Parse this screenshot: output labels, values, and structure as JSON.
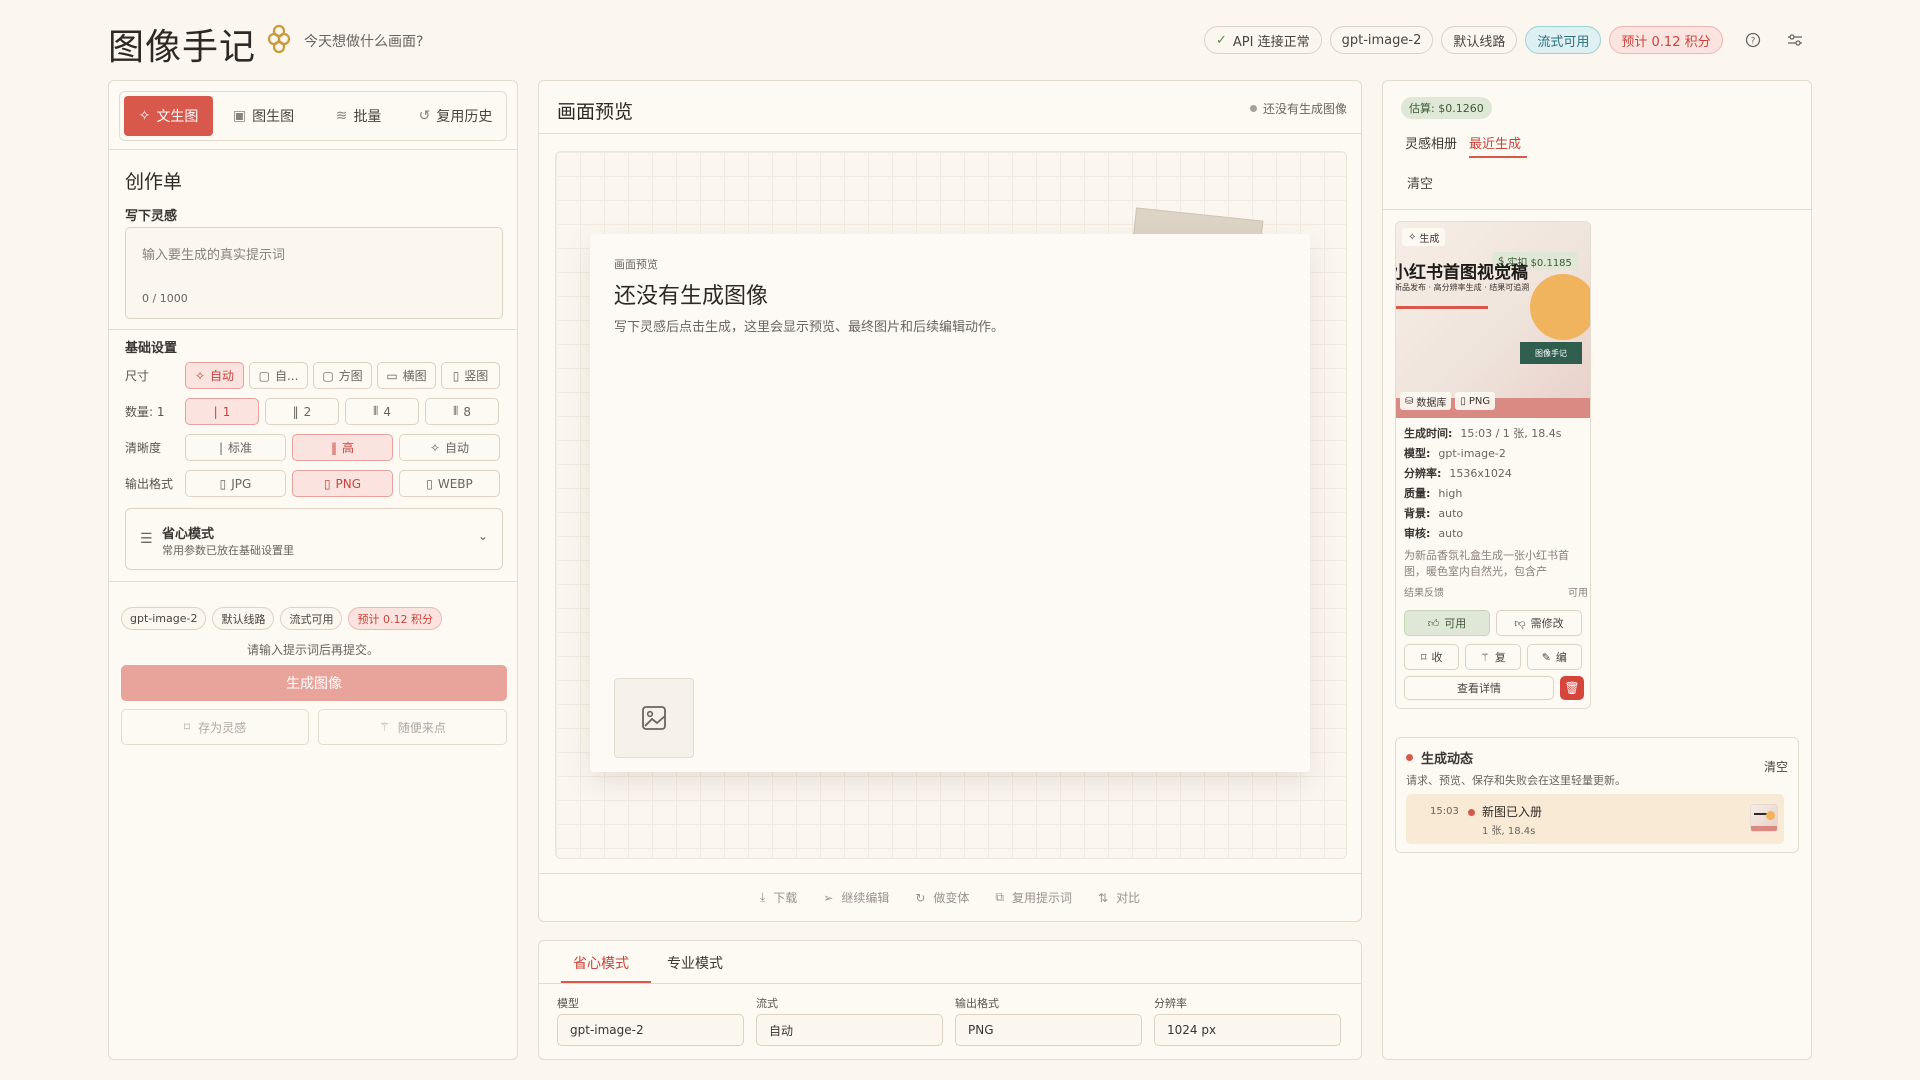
{
  "header": {
    "title": "图像手记",
    "subtitle": "今天想做什么画面?",
    "api_status": "API 连接正常",
    "model": "gpt-image-2",
    "route": "默认线路",
    "stream": "流式可用",
    "cost": "预计 0.12 积分"
  },
  "left": {
    "tabs": [
      "文生图",
      "图生图",
      "批量",
      "复用历史"
    ],
    "section_title": "创作单",
    "prompt_label": "写下灵感",
    "prompt_placeholder": "输入要生成的真实提示词",
    "prompt_count": "0 / 1000",
    "basic_title": "基础设置",
    "size_label": "尺寸",
    "size_options": [
      "自动",
      "自...",
      "方图",
      "横图",
      "竖图"
    ],
    "count_label": "数量: 1",
    "count_options": [
      "1",
      "2",
      "4",
      "8"
    ],
    "quality_label": "清晰度",
    "quality_options": [
      "标准",
      "高",
      "自动"
    ],
    "format_label": "输出格式",
    "format_options": [
      "JPG",
      "PNG",
      "WEBP"
    ],
    "easy_title": "省心模式",
    "easy_desc": "常用参数已放在基础设置里",
    "chips": [
      "gpt-image-2",
      "默认线路",
      "流式可用",
      "预计 0.12 积分"
    ],
    "hint": "请输入提示词后再提交。",
    "generate_label": "生成图像",
    "save_label": "存为灵感",
    "random_label": "随便来点"
  },
  "preview": {
    "title": "画面预览",
    "status": "还没有生成图像",
    "card_kicker": "画面预览",
    "card_title": "还没有生成图像",
    "card_desc": "写下灵感后点击生成，这里会显示预览、最终图片和后续编辑动作。",
    "toolbar": [
      "下载",
      "继续编辑",
      "做变体",
      "复用提示词",
      "对比"
    ]
  },
  "bottom": {
    "tabs": [
      "省心模式",
      "专业模式"
    ],
    "fields": [
      {
        "label": "模型",
        "value": "gpt-image-2"
      },
      {
        "label": "流式",
        "value": "自动"
      },
      {
        "label": "输出格式",
        "value": "PNG"
      },
      {
        "label": "分辨率",
        "value": "1024 px"
      }
    ]
  },
  "right": {
    "estimate": "估算: $0.1260",
    "tabs": [
      "灵感相册",
      "最近生成"
    ],
    "clear": "清空",
    "thumb": {
      "badge": "生成",
      "cost": "实扣 $0.1185",
      "headline": "小红书首图视觉稿",
      "tagline": "新品发布 · 高分辨率生成 · 结果可追溯",
      "brand": "图像手记",
      "tag_db": "数据库",
      "tag_fmt": "PNG"
    },
    "meta": [
      {
        "k": "生成时间:",
        "v": "15:03 / 1 张, 18.4s"
      },
      {
        "k": "模型:",
        "v": "gpt-image-2"
      },
      {
        "k": "分辨率:",
        "v": "1536x1024"
      },
      {
        "k": "质量:",
        "v": "high"
      },
      {
        "k": "背景:",
        "v": "auto"
      },
      {
        "k": "审核:",
        "v": "auto"
      }
    ],
    "desc": "为新品香氛礼盒生成一张小红书首图，暖色室内自然光，包含产",
    "feedback_label": "结果反馈",
    "feedback_value": "可用",
    "good": "可用",
    "bad": "需修改",
    "act_fav": "收",
    "act_redo": "复",
    "act_edit": "编",
    "detail": "查看详情",
    "activity_title": "生成动态",
    "activity_clear": "清空",
    "activity_desc": "请求、预览、保存和失败会在这里轻量更新。",
    "event_time": "15:03",
    "event_title": "新图已入册",
    "event_sub": "1 张, 18.4s"
  }
}
